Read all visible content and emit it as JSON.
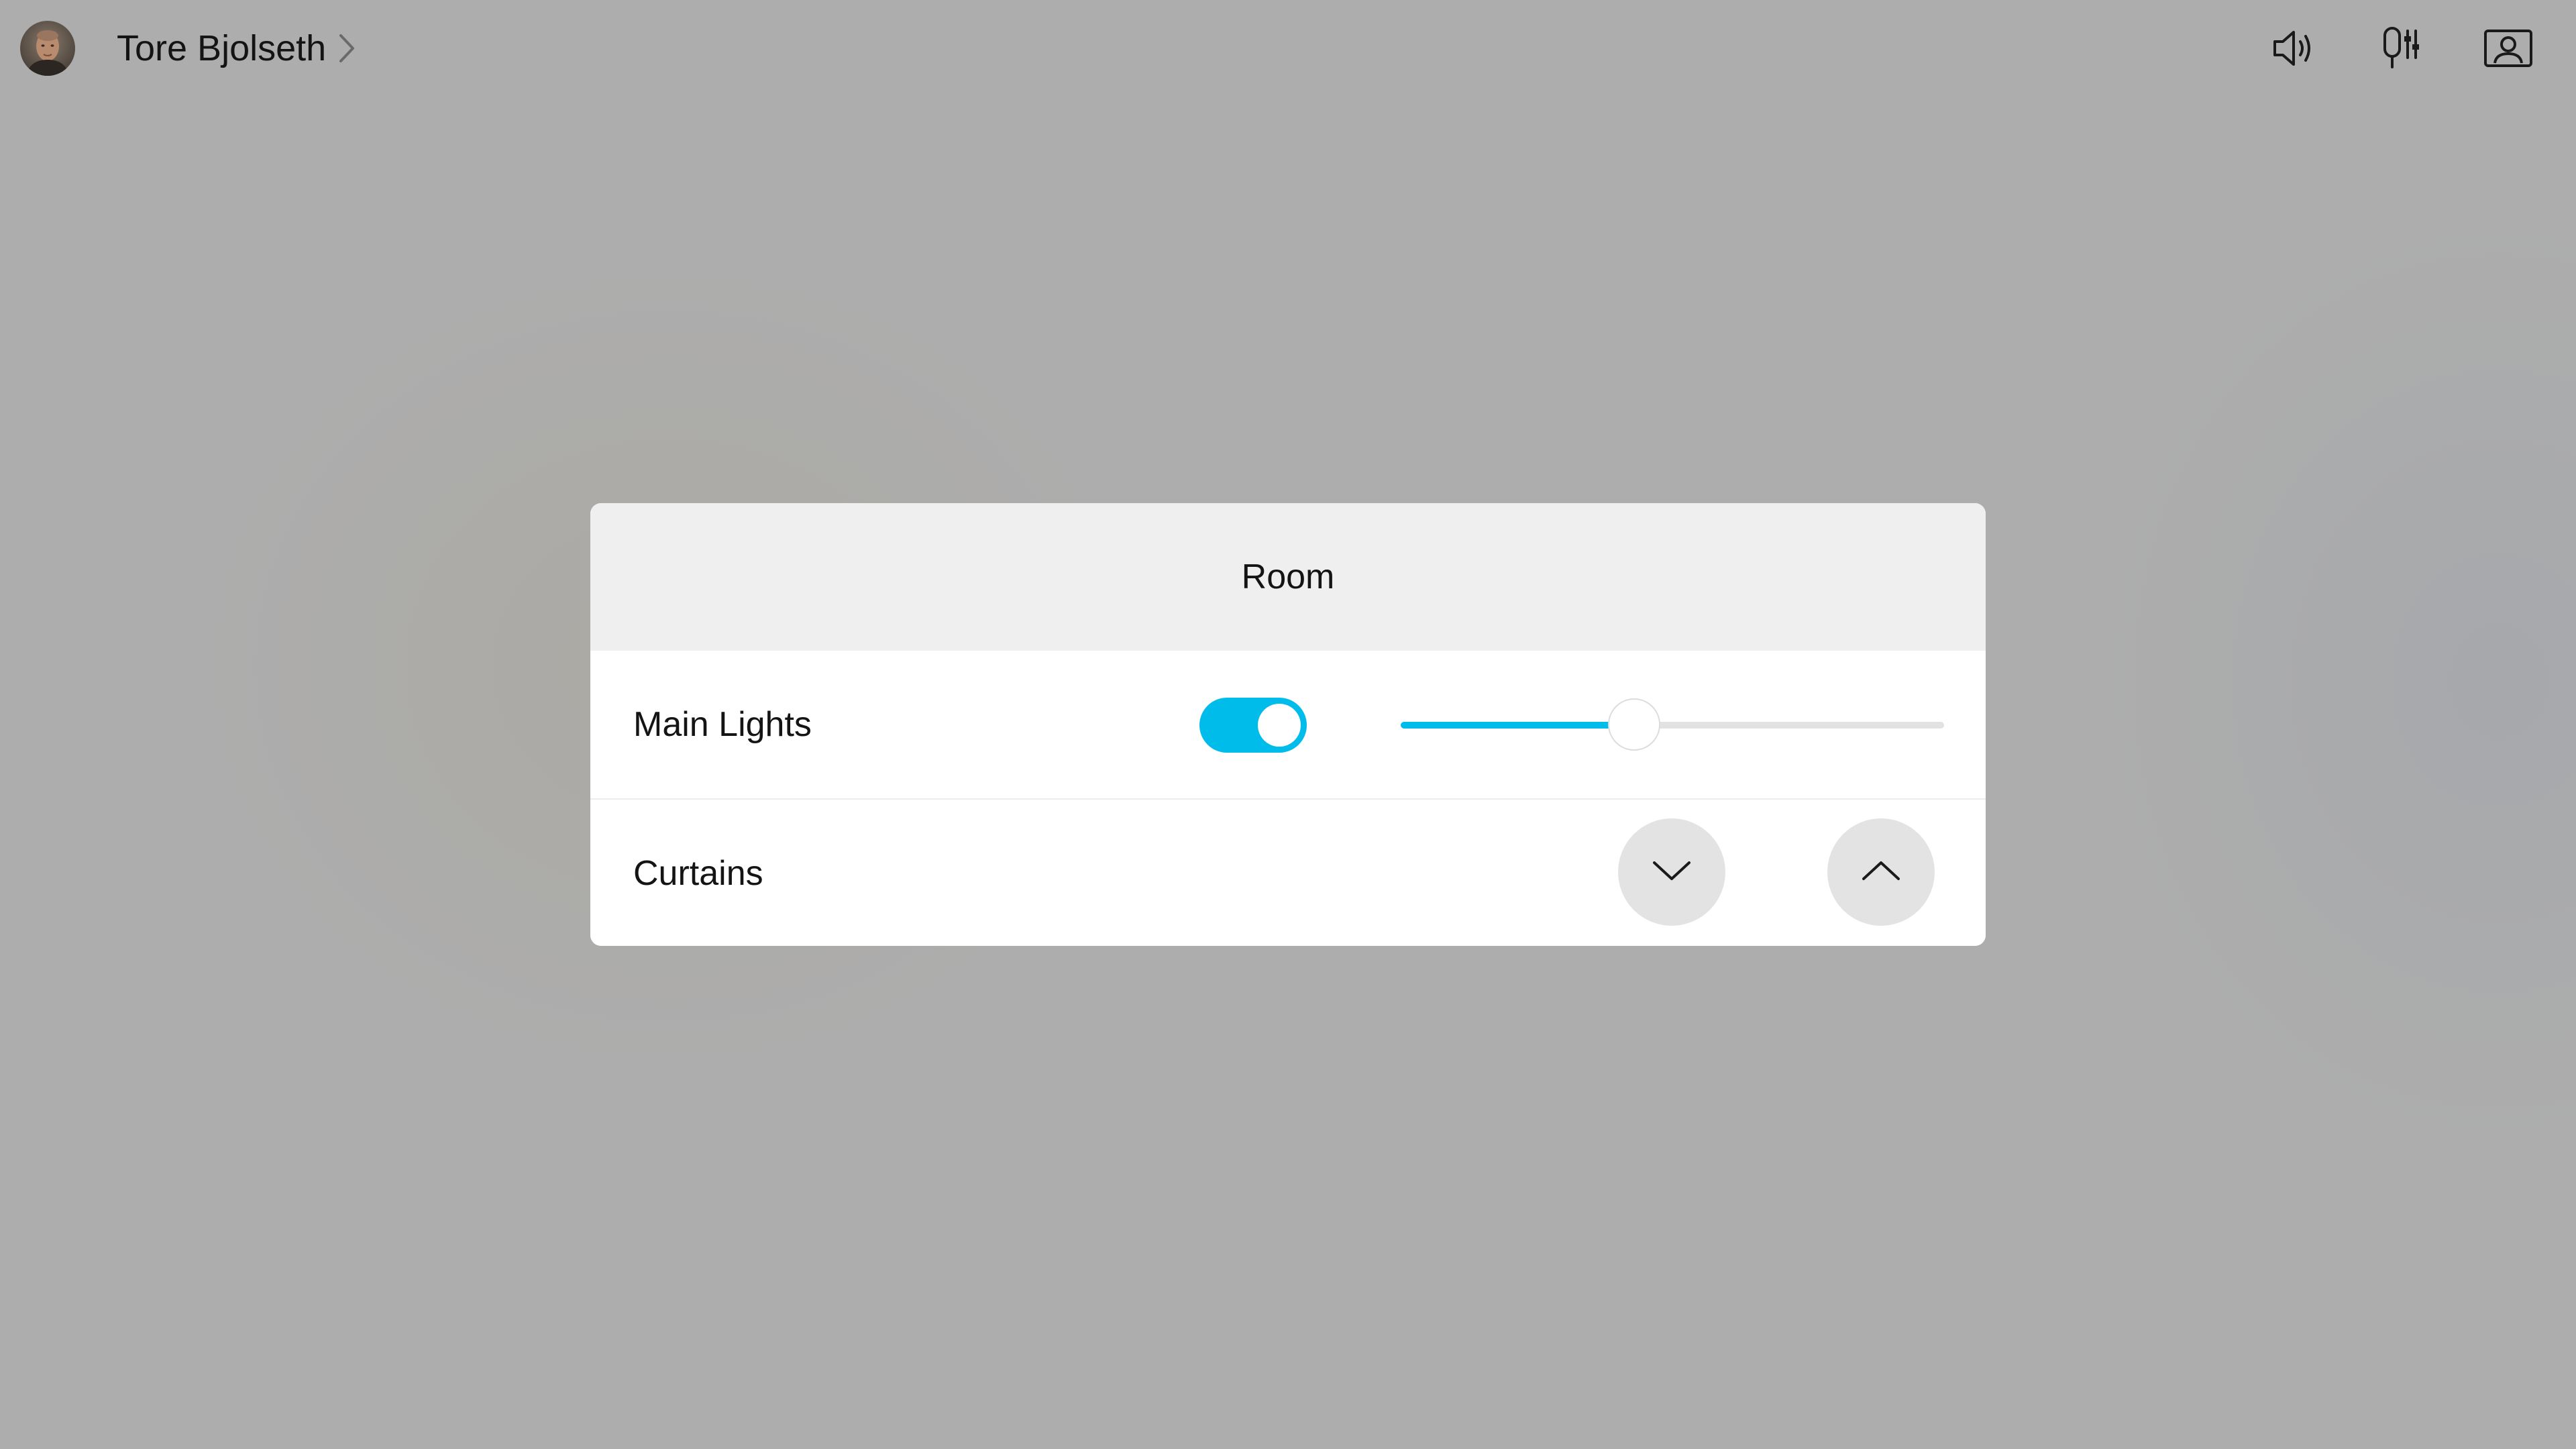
{
  "topbar": {
    "user_name": "Tore Bjolseth",
    "icons": [
      "avatar",
      "chevron-right-icon",
      "speaker-volume-icon",
      "microphone-settings-icon",
      "self-view-icon"
    ]
  },
  "panel": {
    "title": "Room",
    "main_lights": {
      "label": "Main Lights",
      "toggle_on": true,
      "brightness_percent": 43
    },
    "curtains": {
      "label": "Curtains",
      "down_icon": "chevron-down-icon",
      "up_icon": "chevron-up-icon"
    }
  },
  "colors": {
    "accent": "#00bceb",
    "background": "#adadad",
    "panel_header": "#efefef",
    "button": "#e3e3e3"
  }
}
